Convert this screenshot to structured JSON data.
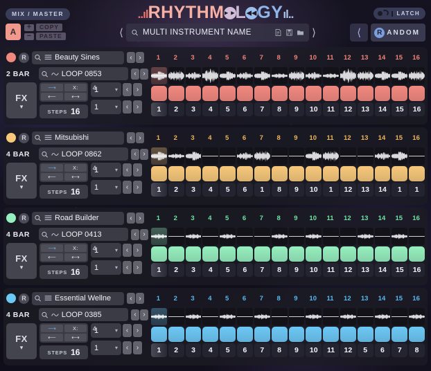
{
  "header": {
    "mix_master_label": "MIX / MASTER",
    "logo": {
      "tick_left": "..ıl",
      "part1": "RHYTHM",
      "glyph1_icon": "play-forward-icon",
      "part2": "L",
      "glyph2_icon": "rewind-icon",
      "part3": "GY",
      "tick_right": "ıl.."
    },
    "latch": {
      "label": "LATCH",
      "icon": "latch-toggle-icon"
    },
    "slot_a": "A",
    "copy_label": "COPY",
    "paste_label": "PASTE",
    "plus_label": "+",
    "minus_label": "−",
    "browser": {
      "prev_icon": "chevron-left-icon",
      "next_icon": "chevron-right-icon",
      "search_icon": "search-icon",
      "preset_name": "MULTI INSTRUMENT NAME",
      "placeholder": "MULTI INSTRUMENT NAME",
      "icons": [
        "new-file-icon",
        "save-disk-icon",
        "open-folder-icon"
      ]
    },
    "random_prev_icon": "chevron-left-icon",
    "random": {
      "badge": "R",
      "label": "ANDOM"
    }
  },
  "colors": {
    "track1": "#f2897f",
    "track1_num": "#f08477",
    "track2": "#f7c87a",
    "track2_num": "#eeb55c",
    "track3": "#96efbe",
    "track3_num": "#6fe3a4",
    "track4": "#6cc8f5",
    "track4_num": "#57b9ef",
    "accent_blue": "#6fb6f0",
    "panel": "#1c1b24"
  },
  "common": {
    "record_icon": "record-dot-icon",
    "r_button": "R",
    "search_icon": "search-icon",
    "list_icon": "list-lines-icon",
    "wave_icon": "waveform-icon",
    "prev_icon": "‹",
    "next_icon": "›",
    "fx_label": "FX",
    "fx_chevron_icon": "chevron-down-icon",
    "steps_label": "STEPS",
    "dir_forward_icon": "arrow-right-icon",
    "dir_backward_icon": "arrow-left-icon",
    "dir_x_label": "X:",
    "dir_pingpong_icon": "arrow-both-icon",
    "dropdown_chevron_icon": "chevron-down-icon"
  },
  "tracks": [
    {
      "id": "track-1",
      "color": "#f2897f",
      "num_color": "#f08477",
      "instrument": "Beauty Sines",
      "bars": "2 BAR",
      "loop": "LOOP 0853",
      "x_value": "4",
      "steps": "16",
      "select_top": "1",
      "select_bottom": "1",
      "step_numbers_top": [
        "1",
        "2",
        "3",
        "4",
        "5",
        "6",
        "7",
        "8",
        "9",
        "10",
        "11",
        "12",
        "13",
        "14",
        "15",
        "16"
      ],
      "step_numbers_bottom": [
        "1",
        "2",
        "3",
        "4",
        "5",
        "6",
        "7",
        "8",
        "9",
        "10",
        "11",
        "12",
        "13",
        "14",
        "15",
        "16"
      ],
      "waveforms": [
        3,
        4,
        2,
        5,
        3,
        2,
        3,
        1,
        4,
        2,
        1,
        5,
        4,
        3,
        3,
        4
      ]
    },
    {
      "id": "track-2",
      "color": "#f7c87a",
      "num_color": "#eeb55c",
      "instrument": "Mitsubishi",
      "bars": "4 BAR",
      "loop": "LOOP 0862",
      "x_value": "4",
      "steps": "16",
      "select_top": "1",
      "select_bottom": "1",
      "step_numbers_top": [
        "1",
        "2",
        "3",
        "4",
        "5",
        "6",
        "7",
        "8",
        "9",
        "10",
        "11",
        "12",
        "13",
        "14",
        "15",
        "16"
      ],
      "step_numbers_bottom": [
        "1",
        "2",
        "3",
        "4",
        "5",
        "6",
        "1",
        "8",
        "9",
        "10",
        "1",
        "12",
        "13",
        "14",
        "1",
        "1"
      ],
      "waveforms": [
        3,
        1,
        3,
        0,
        0,
        2,
        4,
        0,
        0,
        3,
        4,
        0,
        0,
        2,
        3,
        0
      ]
    },
    {
      "id": "track-3",
      "color": "#96efbe",
      "num_color": "#6fe3a4",
      "instrument": "Road Builder",
      "bars": "4 BAR",
      "loop": "LOOP 0413",
      "x_value": "4",
      "steps": "16",
      "select_top": "1",
      "select_bottom": "1",
      "step_numbers_top": [
        "1",
        "2",
        "3",
        "4",
        "5",
        "6",
        "7",
        "8",
        "9",
        "10",
        "11",
        "12",
        "13",
        "14",
        "15",
        "16"
      ],
      "step_numbers_bottom": [
        "1",
        "2",
        "3",
        "4",
        "5",
        "6",
        "7",
        "8",
        "9",
        "10",
        "11",
        "12",
        "13",
        "14",
        "15",
        "16"
      ],
      "waveforms": [
        1,
        0,
        1,
        0,
        1,
        0,
        0,
        1,
        0,
        1,
        0,
        0,
        1,
        0,
        1,
        0
      ]
    },
    {
      "id": "track-4",
      "color": "#6cc8f5",
      "num_color": "#57b9ef",
      "instrument": "Essential Wellne",
      "bars": "4 BAR",
      "loop": "LOOP 0385",
      "x_value": "4",
      "steps": "16",
      "select_top": "1",
      "select_bottom": "1",
      "step_numbers_top": [
        "1",
        "2",
        "3",
        "4",
        "5",
        "6",
        "7",
        "8",
        "9",
        "10",
        "11",
        "12",
        "13",
        "14",
        "15",
        "16"
      ],
      "step_numbers_bottom": [
        "1",
        "2",
        "3",
        "4",
        "5",
        "6",
        "7",
        "8",
        "9",
        "10",
        "11",
        "12",
        "5",
        "6",
        "7",
        "8"
      ],
      "waveforms": [
        1,
        0,
        1,
        0,
        1,
        0,
        1,
        0,
        0,
        1,
        0,
        1,
        0,
        1,
        0,
        1
      ]
    }
  ]
}
